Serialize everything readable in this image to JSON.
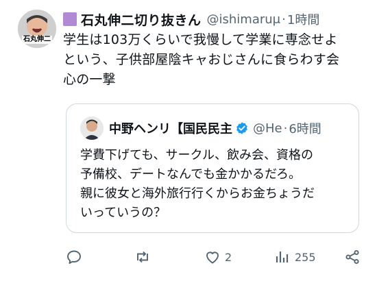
{
  "tweet": {
    "author_name": "石丸伸二切り抜きん",
    "author_handle": "@ishimaruμ",
    "time": "1時間",
    "avatar_text": "石丸伸二",
    "text_lines": [
      "学生は103万くらいで我慢して学業に専念せよ",
      "という、子供部屋陰キャおじさんに食らわす会",
      "心の一撃"
    ]
  },
  "quote": {
    "author_name": "中野ヘンリ【国民民主",
    "author_handle": "@He",
    "time": "6時間",
    "text_lines": [
      "学費下げても、サークル、飲み会、資格の",
      "予備校、デートなんでも金かかるだろ。",
      "親に彼女と海外旅行行くからお金ちょうだ",
      "いっていうの？"
    ]
  },
  "actions": {
    "reply": {
      "icon": "reply-icon",
      "count": ""
    },
    "repost": {
      "icon": "repost-icon",
      "count": ""
    },
    "like": {
      "icon": "like-icon",
      "count": "2"
    },
    "views": {
      "icon": "views-icon",
      "count": "255"
    },
    "share": {
      "icon": "share-icon",
      "count": ""
    }
  },
  "colors": {
    "name_square": "#b18ad6",
    "verified": "#1d9bf0",
    "muted": "#536471",
    "border": "#cfd9de"
  }
}
